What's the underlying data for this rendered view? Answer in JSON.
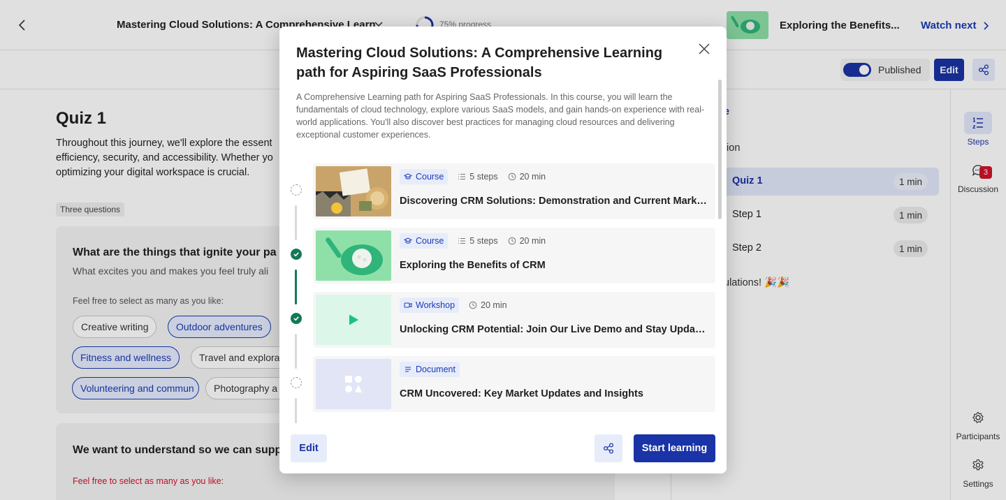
{
  "topbar": {
    "path_title": "Mastering Cloud Solutions: A Comprehensive Learn",
    "progress_text": "75% progress",
    "progress_value": 0.75,
    "next_title": "Exploring the Benefits...",
    "watch_next_label": "Watch next"
  },
  "subbar": {
    "published_label": "Published",
    "edit_label": "Edit"
  },
  "quiz": {
    "title": "Quiz 1",
    "description": "Throughout this journey, we'll explore the essent efficiency, security, and accessibility. Whether yo optimizing your digital workspace is crucial.",
    "tag": "Three questions",
    "q1": {
      "title": "What are the things that ignite your pa",
      "subtitle": "What excites you and makes you feel truly ali",
      "note": "Feel free to select as many as you like:",
      "chips": [
        "Creative writing",
        "Outdoor adventures",
        "Fitness and wellness",
        "Travel and explora",
        "Volunteering and commun",
        "Photography a"
      ]
    },
    "q2": {
      "title": "We want to understand so we can supp",
      "note": "Feel free to select as many as you like:"
    }
  },
  "right_panel": {
    "fragment_top": "e",
    "fragment_section": "tion",
    "rows": [
      {
        "label": "Quiz 1",
        "duration": "1 min"
      },
      {
        "label": "Step 1",
        "duration": "1 min"
      },
      {
        "label": "Step 2",
        "duration": "1 min"
      }
    ],
    "congrats": "ulations! 🎉🎉"
  },
  "rail": {
    "steps": "Steps",
    "discussion": "Discussion",
    "discussion_count": "3",
    "participants": "Participants",
    "settings": "Settings"
  },
  "modal": {
    "title": "Mastering Cloud Solutions: A Comprehensive Learning path for Aspiring SaaS Professionals",
    "description": "A Comprehensive Learning path for Aspiring SaaS Professionals. In this course, you will learn the fundamentals of cloud technology, explore various SaaS models, and gain hands-on experience with real-world applications. You'll also discover best practices for managing cloud resources and delivering exceptional customer experiences.",
    "items": [
      {
        "type": "Course",
        "steps": "5 steps",
        "duration": "20 min",
        "title": "Discovering CRM Solutions: Demonstration and Current Marke...",
        "status": "pending"
      },
      {
        "type": "Course",
        "steps": "5 steps",
        "duration": "20 min",
        "title": "Exploring the Benefits of CRM",
        "status": "done"
      },
      {
        "type": "Workshop",
        "duration": "20 min",
        "title": "Unlocking CRM Potential: Join Our Live Demo and Stay Update...",
        "status": "done"
      },
      {
        "type": "Document",
        "title": "CRM Uncovered: Key Market Updates and Insights",
        "status": "pending"
      }
    ],
    "edit_label": "Edit",
    "start_label": "Start learning"
  },
  "colors": {
    "primary": "#1a33a6",
    "accent_light": "#e7ecfb",
    "success": "#137a54",
    "notification": "#d0142a",
    "required_note": "#d0142a"
  }
}
